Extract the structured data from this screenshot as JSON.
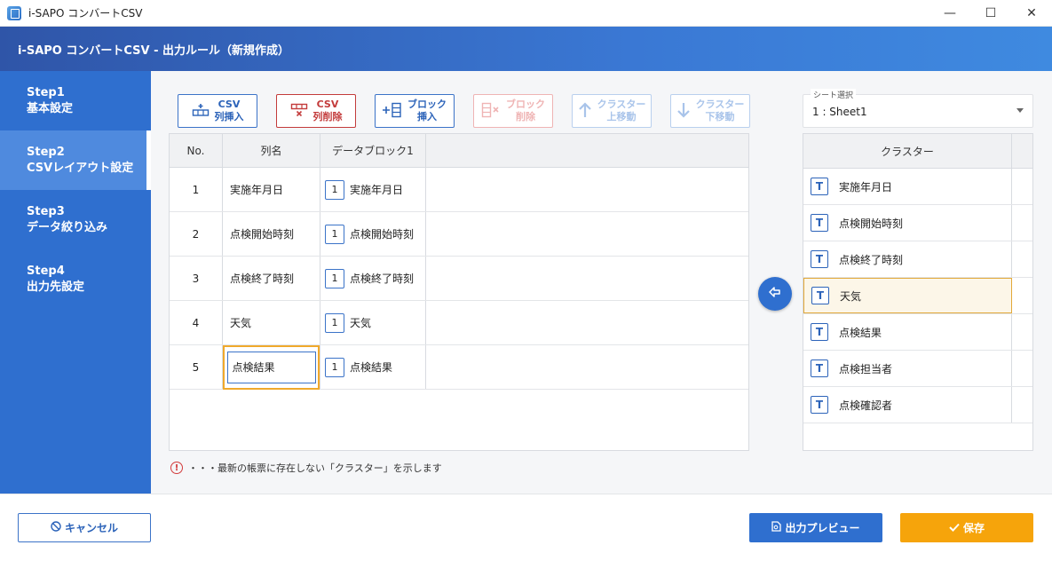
{
  "window": {
    "title": "i-SAPO コンバートCSV",
    "controls": {
      "minimize": "—",
      "maximize": "☐",
      "close": "✕"
    }
  },
  "header": {
    "title": "i-SAPO コンバートCSV - 出力ルール（新規作成）"
  },
  "sidebar": {
    "steps": [
      {
        "step": "Step1",
        "label": "基本設定",
        "active": false
      },
      {
        "step": "Step2",
        "label": "CSVレイアウト設定",
        "active": true
      },
      {
        "step": "Step3",
        "label": "データ絞り込み",
        "active": false
      },
      {
        "step": "Step4",
        "label": "出力先設定",
        "active": false
      }
    ]
  },
  "toolbar": {
    "csv_insert": {
      "line1": "CSV",
      "line2": "列挿入",
      "icon": "column-insert-icon"
    },
    "csv_delete": {
      "line1": "CSV",
      "line2": "列削除",
      "icon": "column-delete-icon"
    },
    "block_insert": {
      "line1": "ブロック",
      "line2": "挿入",
      "icon": "block-insert-icon"
    },
    "block_delete": {
      "line1": "ブロック",
      "line2": "削除",
      "icon": "block-delete-icon"
    },
    "cluster_up": {
      "line1": "クラスター",
      "line2": "上移動",
      "icon": "arrow-up-icon"
    },
    "cluster_down": {
      "line1": "クラスター",
      "line2": "下移動",
      "icon": "arrow-down-icon"
    }
  },
  "grid": {
    "headers": {
      "no": "No.",
      "name": "列名",
      "block": "データブロック1"
    },
    "rows": [
      {
        "no": "1",
        "name": "実施年月日",
        "block_no": "1",
        "block_value": "実施年月日"
      },
      {
        "no": "2",
        "name": "点検開始時刻",
        "block_no": "1",
        "block_value": "点検開始時刻"
      },
      {
        "no": "3",
        "name": "点検終了時刻",
        "block_no": "1",
        "block_value": "点検終了時刻"
      },
      {
        "no": "4",
        "name": "天気",
        "block_no": "1",
        "block_value": "天気"
      },
      {
        "no": "5",
        "name": "点検結果",
        "block_no": "1",
        "block_value": "点検結果"
      }
    ]
  },
  "note": {
    "icon_glyph": "!",
    "text": "・・・最新の帳票に存在しない「クラスター」を示します"
  },
  "sheet": {
    "label": "シート選択",
    "value": "1 : Sheet1"
  },
  "cluster": {
    "header": "クラスター",
    "type_glyph": "T",
    "items": [
      {
        "label": "実施年月日",
        "selected": false
      },
      {
        "label": "点検開始時刻",
        "selected": false
      },
      {
        "label": "点検終了時刻",
        "selected": false
      },
      {
        "label": "天気",
        "selected": true
      },
      {
        "label": "点検結果",
        "selected": false
      },
      {
        "label": "点検担当者",
        "selected": false
      },
      {
        "label": "点検確認者",
        "selected": false
      }
    ]
  },
  "footer": {
    "cancel_label": "キャンセル",
    "preview_label": "出力プレビュー",
    "save_label": "保存"
  },
  "colors": {
    "accent": "#2f6fcf",
    "save": "#f6a40b",
    "danger": "#c33b3b",
    "selection": "#e3a93a"
  }
}
